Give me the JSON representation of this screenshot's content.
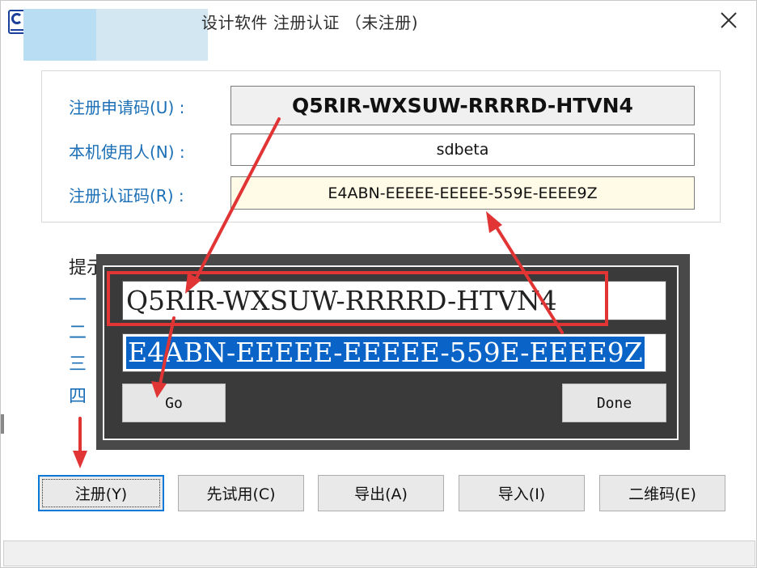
{
  "window": {
    "title": "设计软件 注册认证 （未注册)",
    "close_icon": "close-icon",
    "app_icon": "app-logo-icon"
  },
  "registration": {
    "apply_code_label": "注册申请码(U) :",
    "apply_code_value": "Q5RIR-WXSUW-RRRRD-HTVN4",
    "user_label": "本机使用人(N) :",
    "user_value": "sdbeta",
    "auth_code_label": "注册认证码(R) :",
    "auth_code_value": "E4ABN-EEEEE-EEEEE-559E-EEEE9Z"
  },
  "hints": {
    "title": "提示",
    "items": [
      "一",
      "二",
      "三",
      "四"
    ]
  },
  "keygen": {
    "request_code_value": "Q5RIR-WXSUW-RRRRD-HTVN4",
    "key_value": "E4ABN-EEEEE-EEEEE-559E-EEEE9Z",
    "go_label": "Go",
    "done_label": "Done"
  },
  "buttons": {
    "register": "注册(Y)",
    "trial": "先试用(C)",
    "export": "导出(A)",
    "import": "导入(I)",
    "qrcode": "二维码(E)"
  },
  "colors": {
    "label_blue": "#1b6fb6",
    "annotation_red": "#e13434",
    "selection_blue": "#0a64c8",
    "auth_field_bg": "#fffbe6",
    "focus_border": "#0a78d7"
  }
}
